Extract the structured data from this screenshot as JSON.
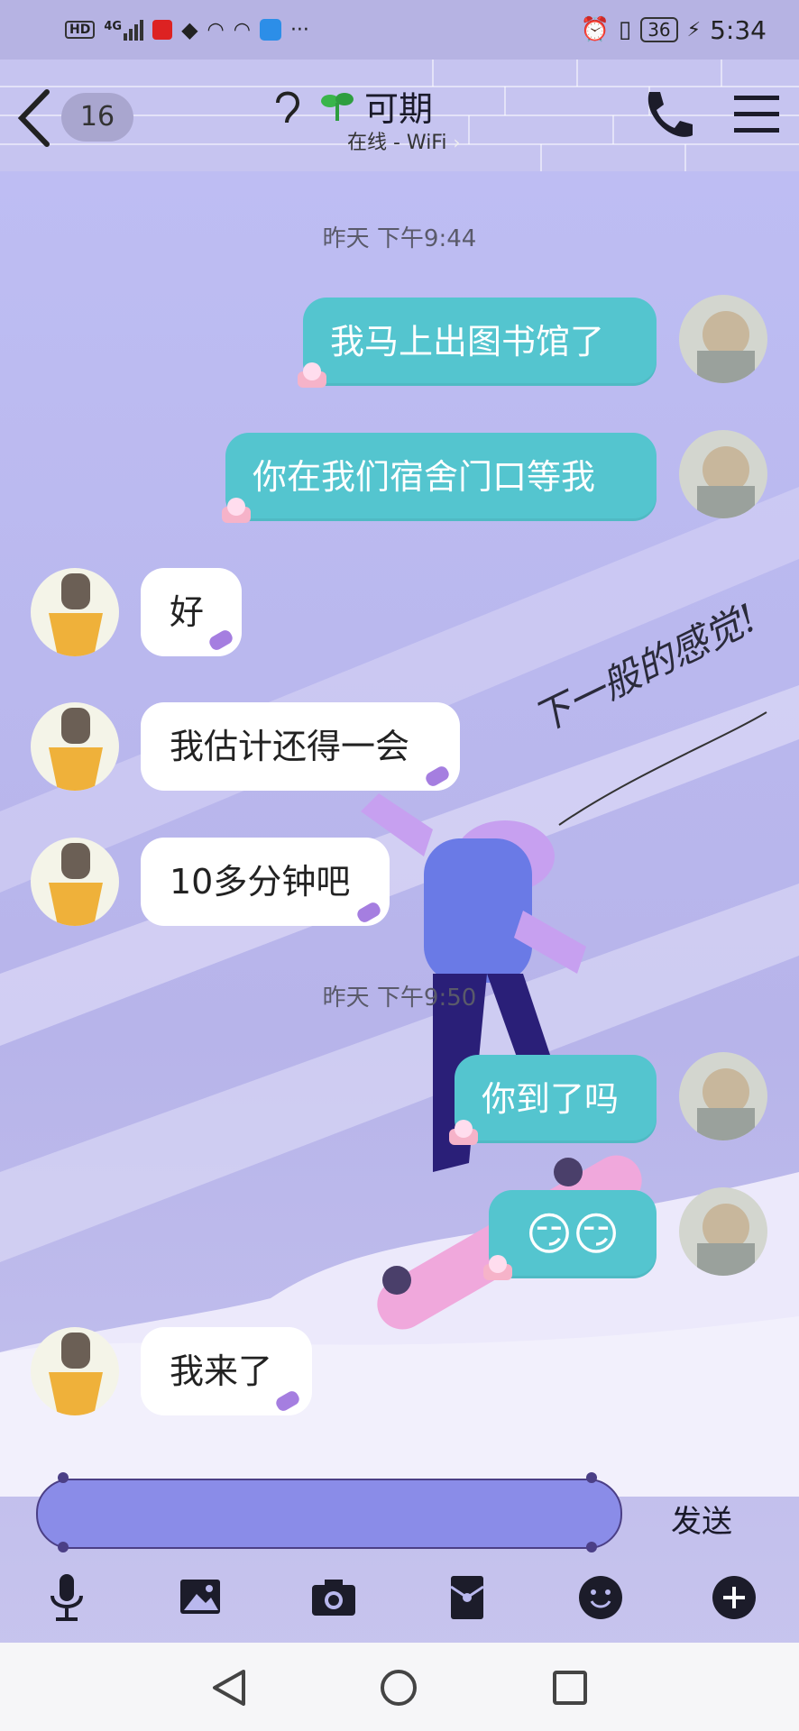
{
  "status_bar": {
    "left_icons": [
      "hd-icon",
      "signal-4g-icon",
      "calendar-app-icon",
      "qq-icon",
      "wifi-icon",
      "wifi-icon",
      "app-icon",
      "more-icon"
    ],
    "network": "4G",
    "battery": "36",
    "time": "5:34"
  },
  "header": {
    "unread_count": "16",
    "contact_name": "可期",
    "status": "在线 - WiFi"
  },
  "messages": [
    {
      "type": "timestamp",
      "text": "昨天 下午9:44"
    },
    {
      "type": "out",
      "text": "我马上出图书馆了"
    },
    {
      "type": "out",
      "text": "你在我们宿舍门口等我"
    },
    {
      "type": "in",
      "text": "好"
    },
    {
      "type": "in",
      "text": "我估计还得一会"
    },
    {
      "type": "in",
      "text": "10多分钟吧"
    },
    {
      "type": "timestamp",
      "text": "昨天 下午9:50"
    },
    {
      "type": "out",
      "text": "你到了吗"
    },
    {
      "type": "out",
      "text": "😏😏"
    },
    {
      "type": "in",
      "text": "我来了"
    }
  ],
  "background_handwriting": "下一般的感觉!",
  "input": {
    "placeholder": "",
    "send_label": "发送"
  },
  "toolbar": [
    "mic-icon",
    "image-icon",
    "camera-icon",
    "red-packet-icon",
    "emoji-icon",
    "plus-icon"
  ],
  "colors": {
    "outgoing_bubble": "#54c5cf",
    "incoming_bubble": "#ffffff",
    "input_bg": "#8a8ce8",
    "background": "#b9b8ee"
  }
}
